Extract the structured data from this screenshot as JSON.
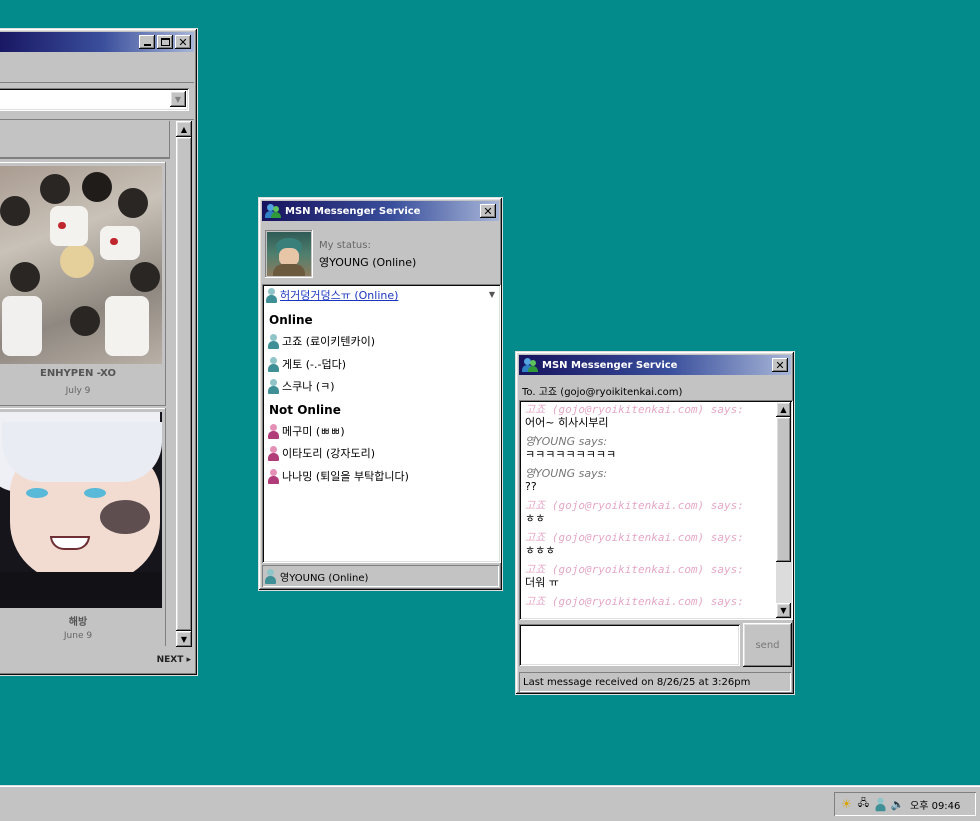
{
  "left_window": {
    "next_label": "NEXT ▸",
    "items": [
      {
        "caption": "ENHYPEN -XO",
        "date": "July 9"
      },
      {
        "caption": "해방",
        "date": "June 9"
      }
    ]
  },
  "msn": {
    "title": "MSN Messenger Service",
    "status_label": "My status:",
    "status_value": "영YOUNG (Online)",
    "selected_contact": "허거덩거덩스ㅠ (Online)",
    "online_header": "Online",
    "online": [
      "고죠 (료이키텐카이)",
      "게토 (-.-덥다)",
      "스쿠나 (ㅋ)"
    ],
    "offline_header": "Not Online",
    "offline": [
      "메구미 (ㅃㅃ)",
      "이타도리 (강자도리)",
      "나나밍 (퇴일을 부탁합니다)"
    ],
    "footer": "영YOUNG (Online)"
  },
  "chat": {
    "title": "MSN Messenger Service",
    "to_line": "To. 고죠 (gojo@ryoikitenkai.com)",
    "messages": [
      {
        "who": "고죠 (gojo@ryoikitenkai.com) says:",
        "text": "어어~ 히사시부리",
        "me": false
      },
      {
        "who": "영YOUNG says:",
        "text": "ㅋㅋㅋㅋㅋㅋㅋㅋㅋ",
        "me": true
      },
      {
        "who": "영YOUNG says:",
        "text": "??",
        "me": true
      },
      {
        "who": "고죠 (gojo@ryoikitenkai.com) says:",
        "text": "ㅎㅎ",
        "me": false
      },
      {
        "who": "고죠 (gojo@ryoikitenkai.com) says:",
        "text": "ㅎㅎㅎ",
        "me": false
      },
      {
        "who": "고죠 (gojo@ryoikitenkai.com) says:",
        "text": "더워 ㅠ",
        "me": false
      },
      {
        "who": "고죠 (gojo@ryoikitenkai.com) says:",
        "text": "",
        "me": false
      }
    ],
    "send_label": "send",
    "status_bar": "Last message received on 8/26/25 at 3:26pm"
  },
  "taskbar": {
    "clock": "오후 09:46",
    "icons": [
      "sun-icon",
      "network-icon",
      "user-icon",
      "volume-icon"
    ]
  }
}
